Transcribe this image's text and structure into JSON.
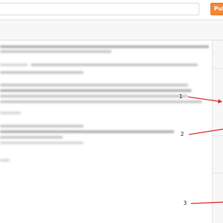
{
  "header": {
    "publish_label": "Pub"
  },
  "annotations": {
    "markers": [
      "1",
      "2",
      "3"
    ],
    "arrow_color": "#e02020"
  },
  "colors": {
    "accent": "#f58634"
  }
}
